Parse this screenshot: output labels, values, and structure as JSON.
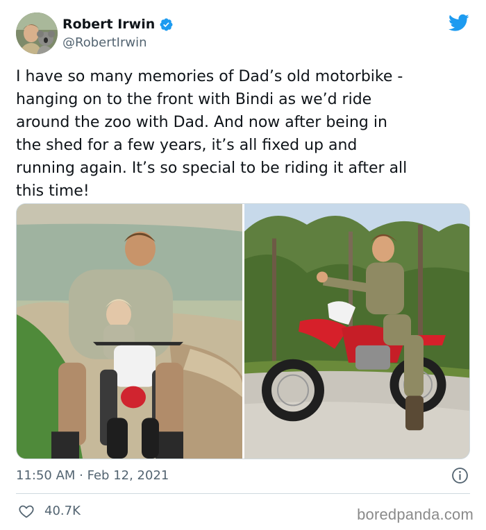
{
  "author": {
    "display_name": "Robert Irwin",
    "handle": "@RobertIrwin",
    "verified": true,
    "avatar_icon": "user-avatar"
  },
  "tweet": {
    "text": "I have so many memories of Dad’s old motorbike -\nhanging on to the front with Bindi as we’d ride\naround the zoo with Dad. And now after being in\nthe shed for a few years, it’s all fixed up and\nrunning again. It’s so special to be riding it after all\nthis time!",
    "time": "11:50 AM",
    "separator": "·",
    "date": "Feb 12, 2021",
    "timestamp": "11:50 AM · Feb 12, 2021"
  },
  "engagement": {
    "likes": "40.7K"
  },
  "watermark": "boredpanda.com",
  "colors": {
    "twitter_blue": "#1d9bf0",
    "text_primary": "#0f1419",
    "text_secondary": "#536471",
    "divider": "#cfd9de",
    "watermark": "#8a8a8a"
  },
  "icons": {
    "brand": "twitter-bird-icon",
    "verified": "verified-badge-icon",
    "info": "info-icon",
    "like": "heart-icon"
  }
}
